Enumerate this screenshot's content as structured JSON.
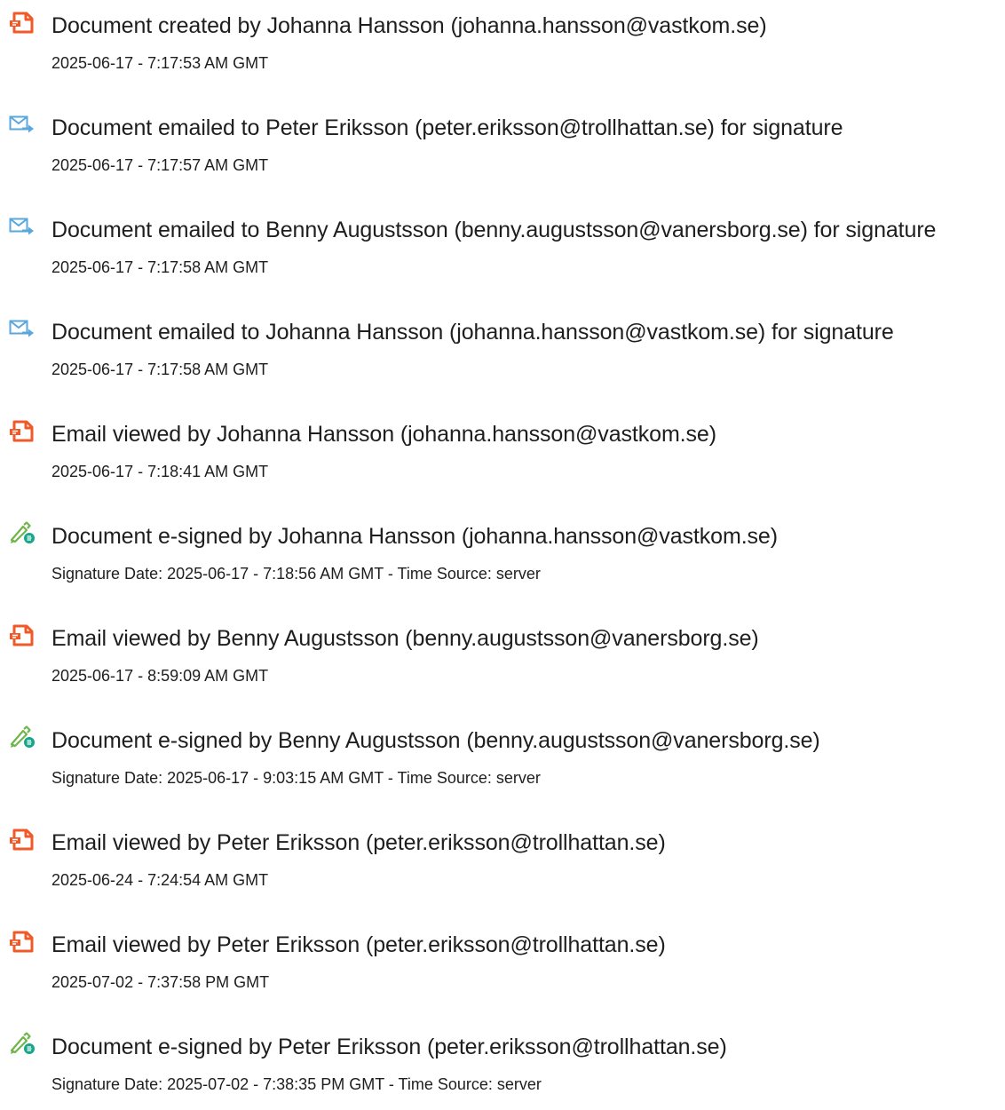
{
  "colors": {
    "doc_icon": "#f05a28",
    "mail_icon": "#5aa7dc",
    "pen_icon_body": "#70b54b",
    "pen_icon_badge": "#17a68a"
  },
  "events": [
    {
      "icon": "document-icon",
      "text": "Document created by Johanna Hansson (johanna.hansson@vastkom.se)",
      "time": "2025-06-17 - 7:17:53 AM GMT"
    },
    {
      "icon": "email-icon",
      "text": "Document emailed to Peter Eriksson (peter.eriksson@trollhattan.se) for signature",
      "time": "2025-06-17 - 7:17:57 AM GMT"
    },
    {
      "icon": "email-icon",
      "text": "Document emailed to Benny Augustsson (benny.augustsson@vanersborg.se) for signature",
      "time": "2025-06-17 - 7:17:58 AM GMT"
    },
    {
      "icon": "email-icon",
      "text": "Document emailed to Johanna Hansson (johanna.hansson@vastkom.se) for signature",
      "time": "2025-06-17 - 7:17:58 AM GMT"
    },
    {
      "icon": "document-icon",
      "text": "Email viewed by Johanna Hansson (johanna.hansson@vastkom.se)",
      "time": "2025-06-17 - 7:18:41 AM GMT"
    },
    {
      "icon": "esign-pen-icon",
      "text": "Document e-signed by Johanna Hansson (johanna.hansson@vastkom.se)",
      "time": "Signature Date: 2025-06-17 - 7:18:56 AM GMT - Time Source: server"
    },
    {
      "icon": "document-icon",
      "text": "Email viewed by Benny Augustsson (benny.augustsson@vanersborg.se)",
      "time": "2025-06-17 - 8:59:09 AM GMT"
    },
    {
      "icon": "esign-pen-icon",
      "text": "Document e-signed by Benny Augustsson (benny.augustsson@vanersborg.se)",
      "time": "Signature Date: 2025-06-17 - 9:03:15 AM GMT - Time Source: server"
    },
    {
      "icon": "document-icon",
      "text": "Email viewed by Peter Eriksson (peter.eriksson@trollhattan.se)",
      "time": "2025-06-24 - 7:24:54 AM GMT"
    },
    {
      "icon": "document-icon",
      "text": "Email viewed by Peter Eriksson (peter.eriksson@trollhattan.se)",
      "time": "2025-07-02 - 7:37:58 PM GMT"
    },
    {
      "icon": "esign-pen-icon",
      "text": "Document e-signed by Peter Eriksson (peter.eriksson@trollhattan.se)",
      "time": "Signature Date: 2025-07-02 - 7:38:35 PM GMT - Time Source: server"
    }
  ]
}
